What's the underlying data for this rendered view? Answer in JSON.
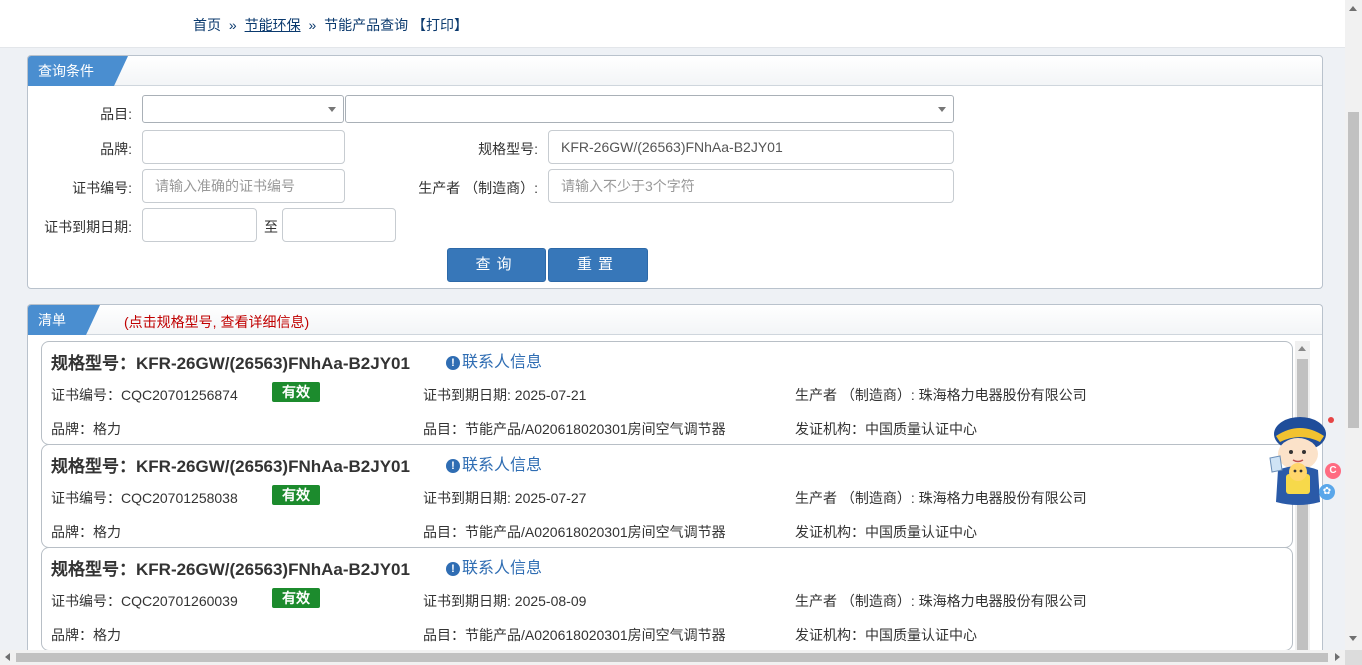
{
  "breadcrumb": {
    "home": "首页",
    "sep1": "»",
    "section": "节能环保",
    "sep2": "»",
    "current": "节能产品查询",
    "print": "【打印】"
  },
  "query": {
    "tab_title": "查询条件",
    "category_label": "品目:",
    "category_value": "",
    "subcategory_value": "",
    "brand_label": "品牌:",
    "brand_value": "",
    "model_label": "规格型号:",
    "model_value": "KFR-26GW/(26563)FNhAa-B2JY01",
    "cert_no_label": "证书编号:",
    "cert_no_placeholder": "请输入准确的证书编号",
    "producer_label": "生产者 （制造商）:",
    "producer_placeholder": "请输入不少于3个字符",
    "expiry_label": "证书到期日期:",
    "expiry_from": "",
    "expiry_to_label": "至",
    "expiry_to": "",
    "search_button": "查询",
    "reset_button": "重置"
  },
  "list": {
    "tab_title": "清单",
    "hint": "(点击规格型号, 查看详细信息)",
    "model_prefix": "规格型号：",
    "contact_label": "联系人信息",
    "cert_no_prefix": "证书编号：",
    "expiry_prefix": "证书到期日期: ",
    "producer_prefix": "生产者 （制造商）: ",
    "brand_prefix": "品牌：",
    "category_prefix": "品目：",
    "issuer_prefix": "发证机构：",
    "items": [
      {
        "model": "KFR-26GW/(26563)FNhAa-B2JY01",
        "cert_no": "CQC20701256874",
        "status": "有效",
        "expiry": "2025-07-21",
        "producer": "珠海格力电器股份有限公司",
        "brand": "格力",
        "category": "节能产品/A020618020301房间空气调节器",
        "issuer": "中国质量认证中心"
      },
      {
        "model": "KFR-26GW/(26563)FNhAa-B2JY01",
        "cert_no": "CQC20701258038",
        "status": "有效",
        "expiry": "2025-07-27",
        "producer": "珠海格力电器股份有限公司",
        "brand": "格力",
        "category": "节能产品/A020618020301房间空气调节器",
        "issuer": "中国质量认证中心"
      },
      {
        "model": "KFR-26GW/(26563)FNhAa-B2JY01",
        "cert_no": "CQC20701260039",
        "status": "有效",
        "expiry": "2025-08-09",
        "producer": "珠海格力电器股份有限公司",
        "brand": "格力",
        "category": "节能产品/A020618020301房间空气调节器",
        "issuer": "中国质量认证中心"
      }
    ]
  },
  "colors": {
    "accent": "#4a8ed0",
    "button": "#3777b9",
    "valid_badge": "#1c8b2d",
    "hint_red": "#c00000",
    "link": "#2f6db3"
  },
  "icons": {
    "contact": "exclamation-circle-icon",
    "mascot": "mascot-icon"
  },
  "mascot": {
    "badge_c": "C",
    "badge_s": "✿"
  }
}
